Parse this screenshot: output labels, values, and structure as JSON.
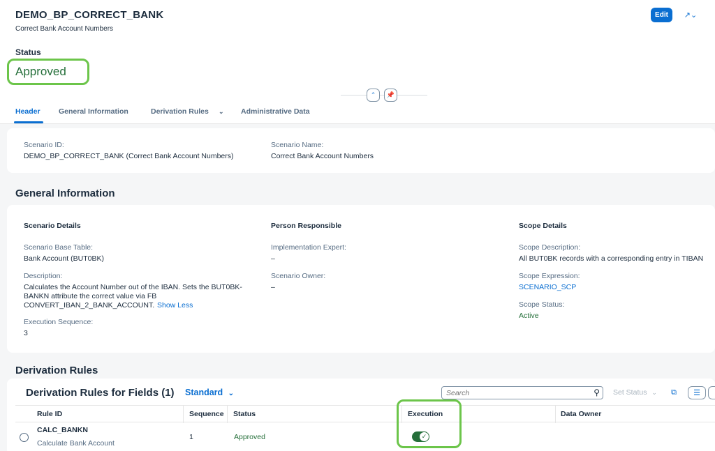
{
  "object": {
    "title": "DEMO_BP_CORRECT_BANK",
    "subtitle": "Correct Bank Account Numbers",
    "edit_label": "Edit",
    "share_icon": "↗⌄"
  },
  "status": {
    "label": "Status",
    "value": "Approved"
  },
  "tabs": [
    {
      "label": "Header"
    },
    {
      "label": "General Information"
    },
    {
      "label": "Derivation Rules"
    },
    {
      "label": "Administrative Data"
    }
  ],
  "header_section": {
    "scenario_id_label": "Scenario ID:",
    "scenario_id_value": "DEMO_BP_CORRECT_BANK (Correct Bank Account Numbers)",
    "scenario_name_label": "Scenario Name:",
    "scenario_name_value": "Correct Bank Account Numbers"
  },
  "general_information": {
    "title": "General Information",
    "scenario_details": {
      "heading": "Scenario Details",
      "base_table_label": "Scenario Base Table:",
      "base_table_value": "Bank Account (BUT0BK)",
      "description_label": "Description:",
      "description_lines": [
        "Calculates the Account Number out of the IBAN. Sets the BUT0BK-",
        "BANKN attribute the correct value via FB",
        "CONVERT_IBAN_2_BANK_ACCOUNT."
      ],
      "show_less": "Show Less",
      "exec_seq_label": "Execution Sequence:",
      "exec_seq_value": "3"
    },
    "person_responsible": {
      "heading": "Person Responsible",
      "impl_expert_label": "Implementation Expert:",
      "impl_expert_value": "–",
      "owner_label": "Scenario Owner:",
      "owner_value": "–"
    },
    "scope_details": {
      "heading": "Scope Details",
      "description_label": "Scope Description:",
      "description_value": "All BUT0BK records with a corresponding entry in TIBAN",
      "expression_label": "Scope Expression:",
      "expression_value": "SCENARIO_SCP",
      "status_label": "Scope Status:",
      "status_value": "Active"
    }
  },
  "derivation_rules": {
    "section_title": "Derivation Rules",
    "table_title": "Derivation Rules for Fields (1)",
    "variant": "Standard",
    "search_placeholder": "Search",
    "set_status": "Set Status",
    "columns": [
      "Rule ID",
      "Sequence",
      "Status",
      "Execution",
      "Data Owner"
    ],
    "rows": [
      {
        "rule_id": "CALC_BANKN",
        "rule_desc": "Calculate Bank Account",
        "sequence": "1",
        "status": "Approved",
        "execution": "on",
        "data_owner": ""
      }
    ]
  },
  "colors": {
    "accent": "#0a6ed1",
    "positive": "#256f3a",
    "highlight": "#6cc54a"
  }
}
